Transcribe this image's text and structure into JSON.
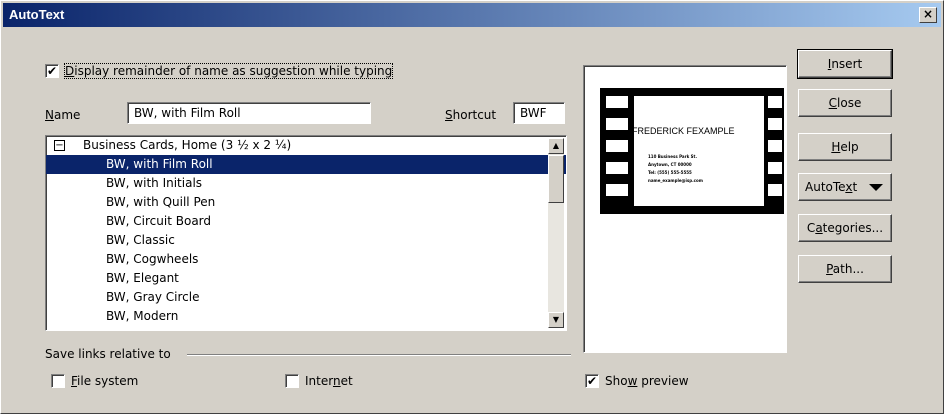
{
  "window": {
    "title": "AutoText",
    "close_glyph": "×"
  },
  "suggestion": {
    "checked": true,
    "label_pre": "D",
    "label_rest": "isplay remainder of name as suggestion while typing"
  },
  "name": {
    "label_u": "N",
    "label_rest": "ame",
    "value": "BW, with Film Roll"
  },
  "shortcut": {
    "label_pre": "",
    "label_u": "S",
    "label_rest": "hortcut",
    "value": "BWF"
  },
  "list": {
    "category": "Business Cards, Home (3 ½ x 2 ¼)",
    "category_toggle": "−",
    "items": [
      "BW, with Film Roll",
      "BW, with Initials",
      "BW, with Quill Pen",
      "BW, Circuit Board",
      "BW, Classic",
      "BW, Cogwheels",
      "BW, Elegant",
      "BW, Gray Circle",
      "BW, Modern"
    ],
    "selected_index": 0
  },
  "save_links": {
    "label": "Save links relative to"
  },
  "file_system": {
    "checked": false,
    "label_u": "F",
    "label_rest": "ile system"
  },
  "internet": {
    "checked": false,
    "label_pre": "Inter",
    "label_u": "n",
    "label_rest": "et"
  },
  "show_preview": {
    "checked": true,
    "label_pre": "Sho",
    "label_u": "w",
    "label_rest": " preview"
  },
  "preview": {
    "card_name": "FREDERICK FEXAMPLE",
    "card_line1": "110 Business Park St.",
    "card_line2": "Anytown, CT 00000",
    "card_line3": "Tel: (555) 555-5555",
    "card_line4": "name_example@isp.com"
  },
  "buttons": {
    "insert": {
      "u": "I",
      "rest": "nsert"
    },
    "close": {
      "u": "C",
      "rest": "lose"
    },
    "help": {
      "u": "H",
      "rest": "elp"
    },
    "autotext": {
      "pre": "AutoTe",
      "u": "x",
      "rest": "t"
    },
    "categories": {
      "pre": "C",
      "u": "a",
      "rest": "tegories..."
    },
    "path": {
      "u": "P",
      "rest": "ath..."
    }
  },
  "checkmark_glyph": "✔"
}
